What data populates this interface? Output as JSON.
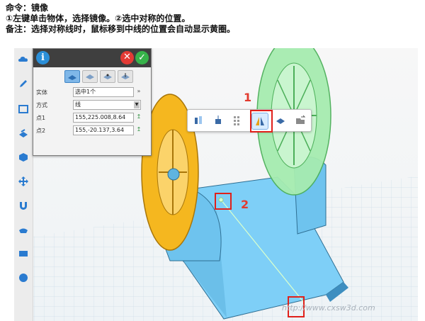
{
  "caption": {
    "line1": "命令：镜像",
    "line2": "①左键单击物体，选择镜像。②选中对称的位置。",
    "line3": "备注：选择对称线时，鼠标移到中线的位置会自动显示黄圈。"
  },
  "left_toolbar": {
    "icons": [
      "cloud-icon",
      "pencil-icon",
      "rectangle-icon",
      "layers-icon",
      "cube-icon",
      "move-icon",
      "magnet-icon",
      "shape-icon",
      "panel-icon",
      "sphere-icon"
    ]
  },
  "panel": {
    "info": "i",
    "close": "✕",
    "ok": "✓",
    "mode_icons": [
      "plane-icon",
      "line-icon",
      "point-icon",
      "axis-icon"
    ],
    "rows": [
      {
        "label": "实体",
        "value": "选中1个"
      },
      {
        "label": "方式",
        "value": "线"
      },
      {
        "label": "点1",
        "value": "155,225.008,8.64"
      },
      {
        "label": "点2",
        "value": "155,-20.137,3.64"
      }
    ],
    "expand_glyph": "»",
    "pick_glyph": "↥"
  },
  "floating_toolbar": {
    "icons": [
      "flip-icon",
      "mirror-left-icon",
      "array-icon",
      "mirror-icon",
      "copy-icon",
      "export-icon"
    ],
    "active": "mirror-icon"
  },
  "markers": {
    "one": "1",
    "two": "2"
  },
  "watermark": "http://www.cxsw3d.com",
  "colors": {
    "accent": "#2b8fd8",
    "red": "#e0201a",
    "green": "#37b34a",
    "model_blue": "#7ecff7",
    "wheel_yellow": "#f5b71f",
    "wheel_green": "#8fe29a"
  }
}
